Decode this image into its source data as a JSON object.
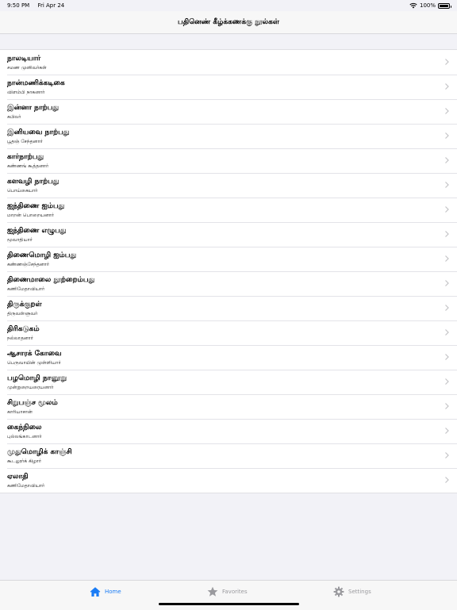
{
  "status_bar": {
    "time": "9:50 PM",
    "date": "Fri Apr 24",
    "battery": "100%"
  },
  "nav": {
    "title": "பதினெண் கீழ்க்கணக்கு நூல்கள்"
  },
  "books": [
    {
      "title": "நாலடியார்",
      "author": "சமண முனிவர்கள்"
    },
    {
      "title": "நான்மணிக்கடிகை",
      "author": "விளம்பி நாகனார்"
    },
    {
      "title": "இன்னா நாற்பது",
      "author": "கபிலர்"
    },
    {
      "title": "இனியவை நாற்பது",
      "author": "பூதஞ் சேந்தனார்"
    },
    {
      "title": "கார்நாற்பது",
      "author": "கண்ணங் கூத்தனார்"
    },
    {
      "title": "களவழி நாற்பது",
      "author": "பொய்கையார்"
    },
    {
      "title": "ஐந்திணை ஐம்பது",
      "author": "மாறன் பொறையனார்"
    },
    {
      "title": "ஐந்திணை எழுபது",
      "author": "மூவாதியார்"
    },
    {
      "title": "திணைமொழி ஐம்பது",
      "author": "கண்ணஞ்சேந்தனார்"
    },
    {
      "title": "திணைமாலை நூற்றைம்பது",
      "author": "கணிமேதாவியார்"
    },
    {
      "title": "திருக்குறள்",
      "author": "திருவள்ளுவர்"
    },
    {
      "title": "திரிகடுகம்",
      "author": "நல்லாதனார்"
    },
    {
      "title": "ஆசாரக் கோவை",
      "author": "பெருவாயின் முள்ளியார்"
    },
    {
      "title": "பழமொழி நானூறு",
      "author": "முன்றுறையரையனார்"
    },
    {
      "title": "சிறுபஞ்ச மூலம்",
      "author": "காரியாசான்"
    },
    {
      "title": "கைந்நிலை",
      "author": "புல்லங்காடனார்"
    },
    {
      "title": "முதுமொழிக் காஞ்சி",
      "author": "கூடலூர்க் கிழார்"
    },
    {
      "title": "ஏலாதி",
      "author": "கணிமேதாவியார்"
    }
  ],
  "tabs": {
    "home": "Home",
    "favorites": "Favorites",
    "settings": "Settings"
  },
  "colors": {
    "accent": "#1a7cf5",
    "inactive": "#9a9a9e"
  }
}
